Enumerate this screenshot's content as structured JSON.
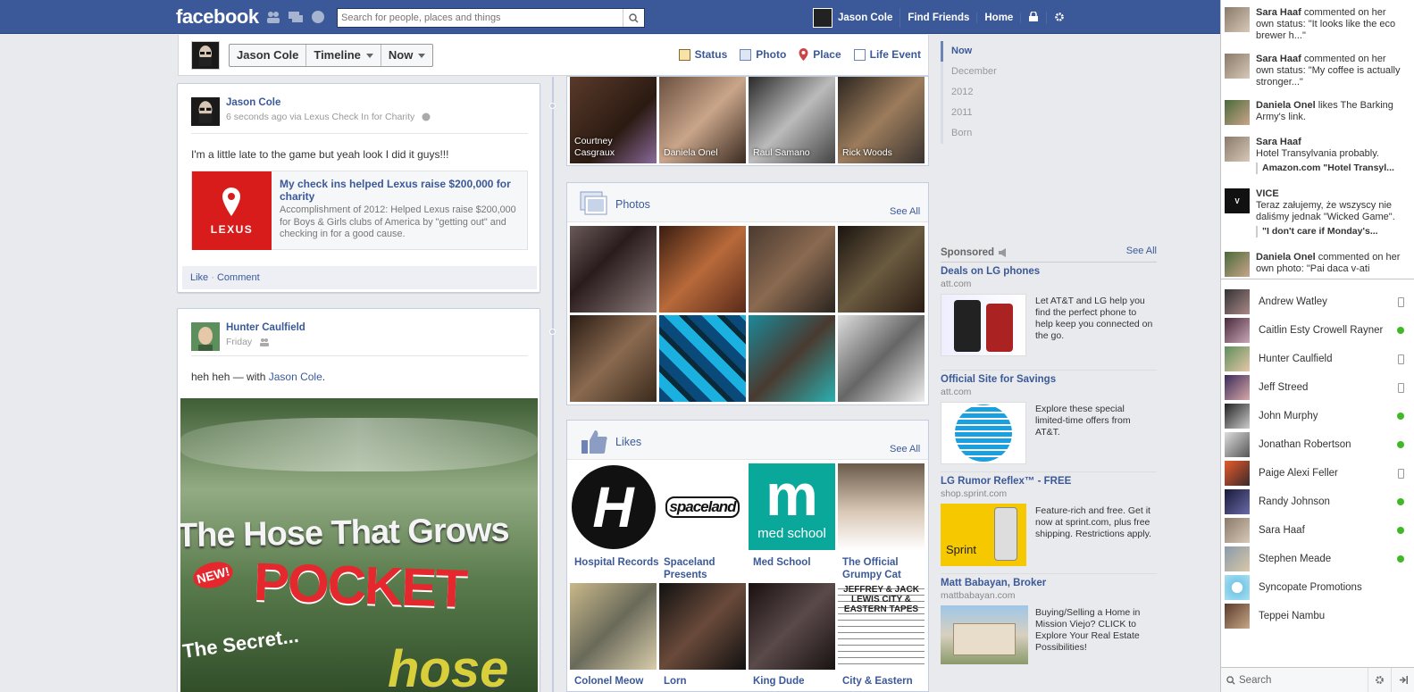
{
  "topbar": {
    "logo": "facebook",
    "search_placeholder": "Search for people, places and things",
    "user_name": "Jason Cole",
    "find_friends": "Find Friends",
    "home": "Home"
  },
  "profile_bar": {
    "crumbs": [
      "Jason Cole",
      "Timeline",
      "Now"
    ],
    "composer": [
      "Status",
      "Photo",
      "Place",
      "Life Event"
    ]
  },
  "post1": {
    "author": "Jason Cole",
    "meta": "6 seconds ago via Lexus Check In for Charity",
    "text": "I'm a little late to the game but yeah look I did it guys!!!",
    "attachment_title": "My check ins helped Lexus raise $200,000 for charity",
    "attachment_desc": "Accomplishment of 2012: Helped Lexus raise $200,000 for Boys & Girls clubs of America by \"getting out\" and checking in for a good cause.",
    "attachment_logo": "LEXUS",
    "like": "Like",
    "comment": "Comment"
  },
  "post2": {
    "author": "Hunter Caulfield",
    "meta": "Friday",
    "text_prefix": "heh heh — with ",
    "text_link": "Jason Cole",
    "text_suffix": ".",
    "photo_line1": "The Hose That Grows",
    "photo_line2": "NEW!",
    "photo_line3": "POCKET",
    "photo_line4": "The Secret...",
    "photo_line5": "hose"
  },
  "friends": [
    "Courtney Casgraux",
    "Daniela Onel",
    "Raul Samano",
    "Rick Woods"
  ],
  "photos": {
    "title": "Photos",
    "see_all": "See All"
  },
  "likes": {
    "title": "Likes",
    "see_all": "See All",
    "items": [
      "Hospital Records",
      "Spaceland Presents",
      "Med School",
      "The Official Grumpy Cat",
      "Colonel Meow",
      "Lorn",
      "King Dude",
      "City & Eastern"
    ],
    "logo_h": "H",
    "logo_spaceland": "spaceland",
    "logo_med_m": "m",
    "logo_med_text": "med school",
    "logo_city": "JEFFREY & JACK LEWIS CITY & EASTERN TAPES"
  },
  "scrubber": [
    "Now",
    "December",
    "2012",
    "2011",
    "Born"
  ],
  "sponsored": {
    "label": "Sponsored",
    "see_all": "See All",
    "ads": [
      {
        "title": "Deals on LG phones",
        "domain": "att.com",
        "body": "Let AT&T and LG help you find the perfect phone to help keep you connected on the go."
      },
      {
        "title": "Official Site for Savings",
        "domain": "att.com",
        "body": "Explore these special limited-time offers from AT&T."
      },
      {
        "title": "LG Rumor Reflex™ - FREE",
        "domain": "shop.sprint.com",
        "body": "Feature-rich and free. Get it now at sprint.com, plus free shipping. Restrictions apply.",
        "logo": "Sprint"
      },
      {
        "title": "Matt Babayan, Broker",
        "domain": "mattbabayan.com",
        "body": "Buying/Selling a Home in Mission Viejo? CLICK to Explore Your Real Estate Possibilities!"
      }
    ]
  },
  "ticker": [
    {
      "name": "Sara Haaf",
      "text": " commented on her own status: \"It looks like the eco brewer h...\""
    },
    {
      "name": "Sara Haaf",
      "text": " commented on her own status: \"My coffee is actually stronger...\""
    },
    {
      "name": "Daniela Onel",
      "text": " likes The Barking Army's link."
    },
    {
      "name": "Sara Haaf",
      "text": "",
      "line2": "Hotel Transylvania probably.",
      "quote": "Amazon.com \"Hotel Transyl..."
    },
    {
      "name": "VICE",
      "text": "",
      "line2": "Teraz załujemy, że wszyscy nie daliśmy jednak \"Wicked Game\".",
      "quote": "\"I don't care if Monday's..."
    },
    {
      "name": "Daniela Onel",
      "text": " commented on her own photo: \"Pai daca v-ati"
    }
  ],
  "chat": [
    {
      "name": "Andrew Watley",
      "status": "mobile"
    },
    {
      "name": "Caitlin Esty Crowell Rayner",
      "status": "online"
    },
    {
      "name": "Hunter Caulfield",
      "status": "mobile"
    },
    {
      "name": "Jeff Streed",
      "status": "mobile"
    },
    {
      "name": "John Murphy",
      "status": "online"
    },
    {
      "name": "Jonathan Robertson",
      "status": "online"
    },
    {
      "name": "Paige Alexi Feller",
      "status": "mobile"
    },
    {
      "name": "Randy Johnson",
      "status": "online"
    },
    {
      "name": "Sara Haaf",
      "status": "online"
    },
    {
      "name": "Stephen Meade",
      "status": "online"
    },
    {
      "name": "Syncopate Promotions",
      "status": "none"
    },
    {
      "name": "Teppei Nambu",
      "status": "none"
    }
  ],
  "chat_search": "Search",
  "colors": {
    "brand": "#3b5998",
    "online": "#42b72a"
  }
}
